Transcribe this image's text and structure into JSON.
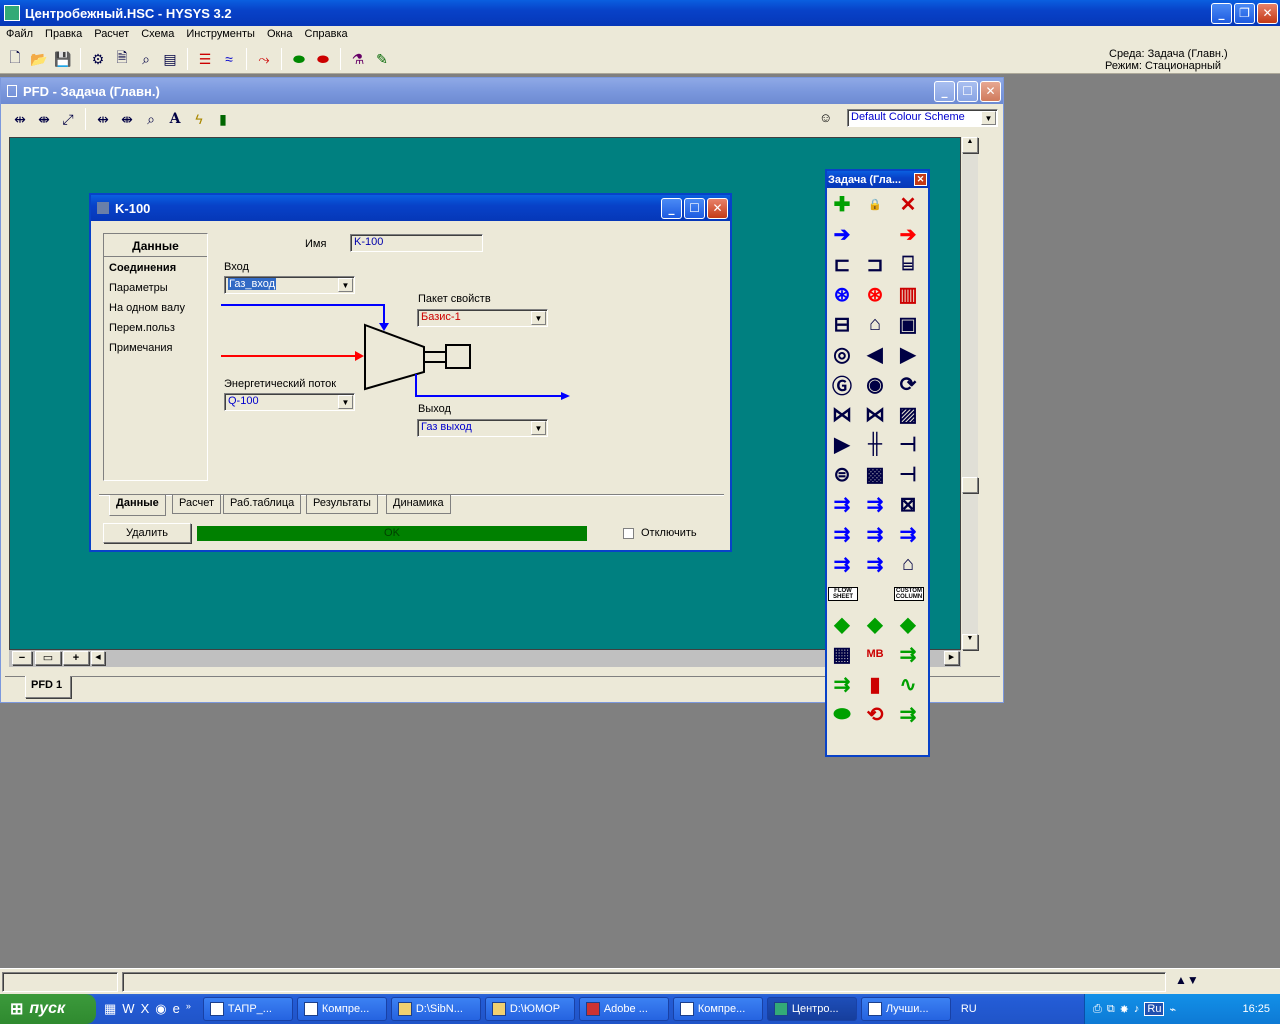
{
  "app": {
    "title": "Центробежный.HSC - HYSYS 3.2",
    "menu": [
      "Файл",
      "Правка",
      "Расчет",
      "Схема",
      "Инструменты",
      "Окна",
      "Справка"
    ],
    "env_label": "Среда: Задача (Главн.)",
    "mode_label": "Режим: Стационарный"
  },
  "pfd": {
    "title": "PFD - Задача (Главн.)",
    "color_scheme": "Default Colour Scheme",
    "tab": "PFD 1"
  },
  "dialog": {
    "title": "K-100",
    "nav_header": "Данные",
    "nav_items": [
      "Соединения",
      "Параметры",
      "На одном валу",
      "Перем.польз",
      "Примечания"
    ],
    "name_label": "Имя",
    "name_value": "K-100",
    "inlet_label": "Вход",
    "inlet_value": "Газ_вход",
    "fluid_pkg_label": "Пакет свойств",
    "fluid_pkg_value": "Базис-1",
    "energy_label": "Энергетический поток",
    "energy_value": "Q-100",
    "outlet_label": "Выход",
    "outlet_value": "Газ выход",
    "tabs": [
      "Данные",
      "Расчет",
      "Раб.таблица",
      "Результаты",
      "Динамика"
    ],
    "delete_label": "Удалить",
    "status": "OK",
    "ignore_label": "Отключить"
  },
  "palette": {
    "title": "Задача (Гла...",
    "flowsheet_label": "FLOW SHEET",
    "column_label": "CUSTOM COLUMN",
    "colors": {
      "material": "#0000ff",
      "energy": "#ff0000",
      "subflow": "#00a000"
    }
  },
  "taskbar": {
    "start": "пуск",
    "tasks": [
      "ТАПР_...",
      "Компре...",
      "D:\\SibN...",
      "D:\\ЮМОР",
      "Adobe ...",
      "Компре...",
      "Центро...",
      "Лучши..."
    ],
    "lang": "RU",
    "tray_lang": "Ru",
    "time": "16:25"
  }
}
